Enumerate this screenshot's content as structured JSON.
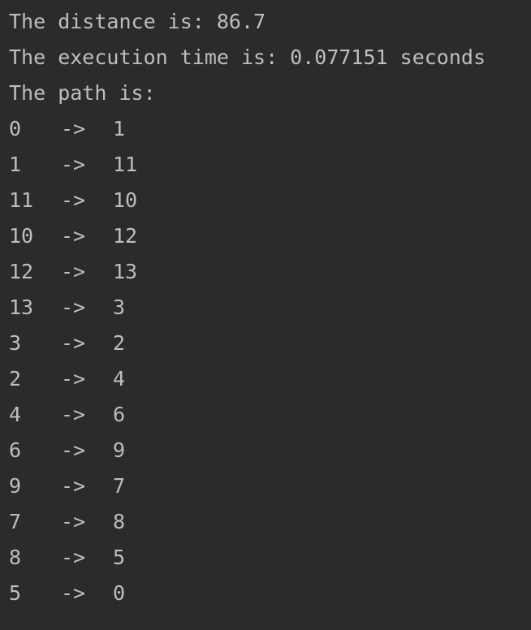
{
  "output": {
    "distance_line": "The distance is: 86.7",
    "time_line": "The execution time is: 0.077151 seconds",
    "path_header": "The path is:",
    "arrow": "->",
    "edges": [
      {
        "from": "0",
        "to": "1"
      },
      {
        "from": "1",
        "to": "11"
      },
      {
        "from": "11",
        "to": "10"
      },
      {
        "from": "10",
        "to": "12"
      },
      {
        "from": "12",
        "to": "13"
      },
      {
        "from": "13",
        "to": "3"
      },
      {
        "from": "3",
        "to": "2"
      },
      {
        "from": "2",
        "to": "4"
      },
      {
        "from": "4",
        "to": "6"
      },
      {
        "from": "6",
        "to": "9"
      },
      {
        "from": "9",
        "to": "7"
      },
      {
        "from": "7",
        "to": "8"
      },
      {
        "from": "8",
        "to": "5"
      },
      {
        "from": "5",
        "to": "0"
      }
    ]
  },
  "colors": {
    "background": "#2b2b2b",
    "text": "#bcbec4"
  }
}
